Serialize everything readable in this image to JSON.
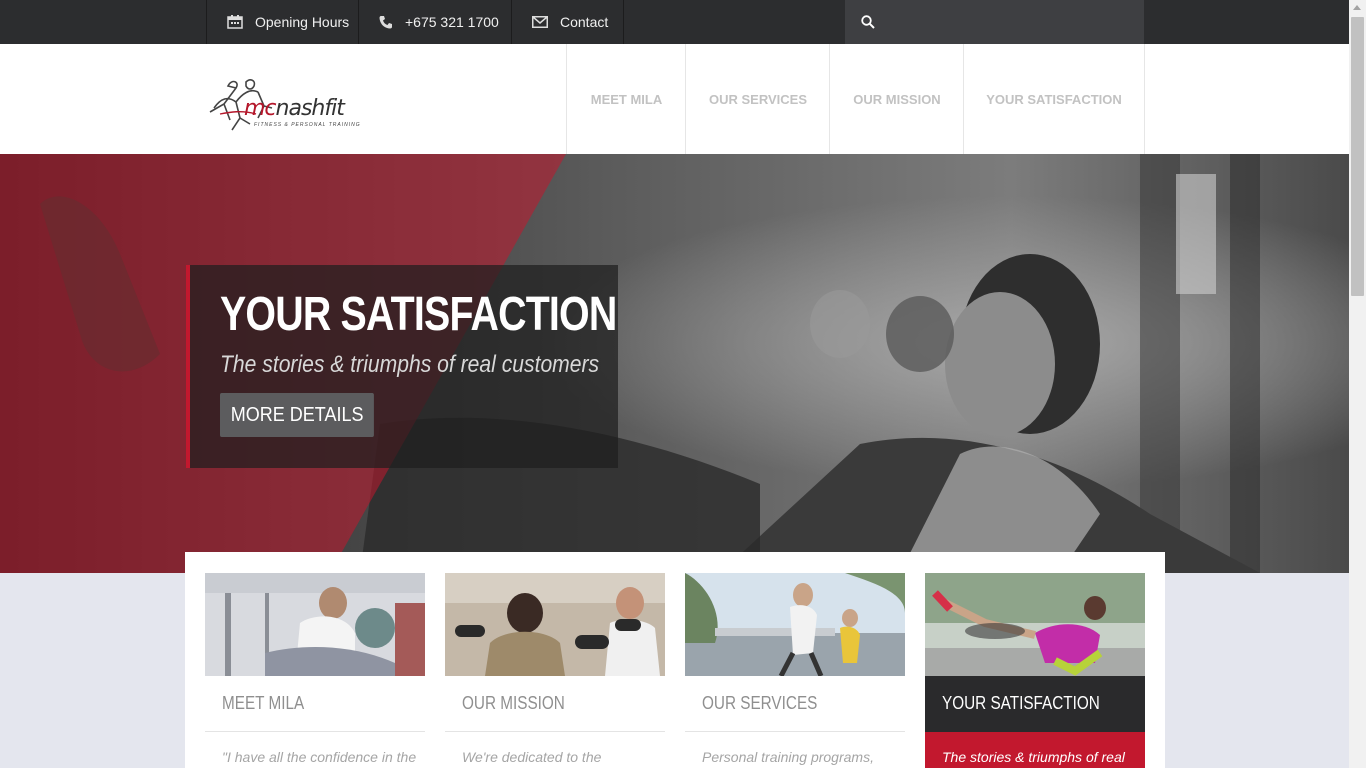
{
  "topbar": {
    "opening_hours": "Opening Hours",
    "phone": "+675 321 1700",
    "contact": "Contact",
    "search_placeholder": ""
  },
  "logo": {
    "wordmark_a": "mc",
    "wordmark_b": "nashfit",
    "tagline": "FITNESS & PERSONAL TRAINING"
  },
  "nav": [
    {
      "label": "MEET MILA"
    },
    {
      "label": "OUR SERVICES"
    },
    {
      "label": "OUR MISSION"
    },
    {
      "label": "YOUR SATISFACTION"
    }
  ],
  "hero": {
    "title": "YOUR SATISFACTION",
    "subtitle": "The stories & triumphs of real customers",
    "button": "MORE  DETAILS"
  },
  "cards": [
    {
      "title": "MEET MILA",
      "desc": "\"I have all the confidence in the"
    },
    {
      "title": "OUR MISSION",
      "desc": "We're dedicated to the"
    },
    {
      "title": "OUR SERVICES",
      "desc": "Personal training programs,"
    },
    {
      "title": "YOUR SATISFACTION",
      "desc": "The stories & triumphs of real"
    }
  ],
  "colors": {
    "accent": "#c2182e",
    "topbar": "#2c2d2f",
    "page_bg": "#e4e6ee"
  }
}
